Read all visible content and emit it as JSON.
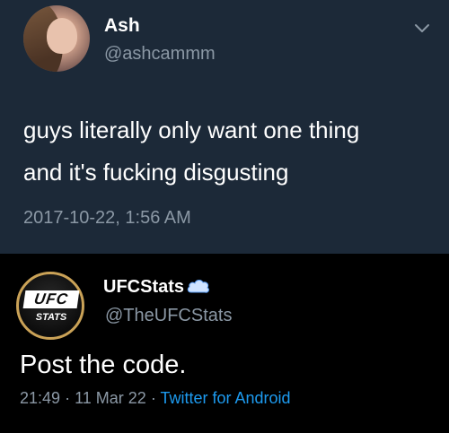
{
  "top_tweet": {
    "display_name": "Ash",
    "handle": "@ashcammm",
    "text": "guys literally only want one thing\nand it's fucking disgusting",
    "timestamp": "2017-10-22, 1:56 AM",
    "menu_icon": "chevron-down-icon"
  },
  "bottom_tweet": {
    "display_name": "UFCStats",
    "handle": "@TheUFCStats",
    "avatar_logo_line1": "UFC",
    "avatar_logo_line2": "STATS",
    "text": "Post the code.",
    "time": "21:49",
    "separator1": "·",
    "date": "11 Mar 22",
    "separator2": "·",
    "source": "Twitter for Android",
    "badge_icon": "cloud-icon"
  },
  "colors": {
    "top_background": "#1c2938",
    "bottom_background": "#000000",
    "muted_text": "#8b98a5",
    "link": "#1d9bf0"
  }
}
